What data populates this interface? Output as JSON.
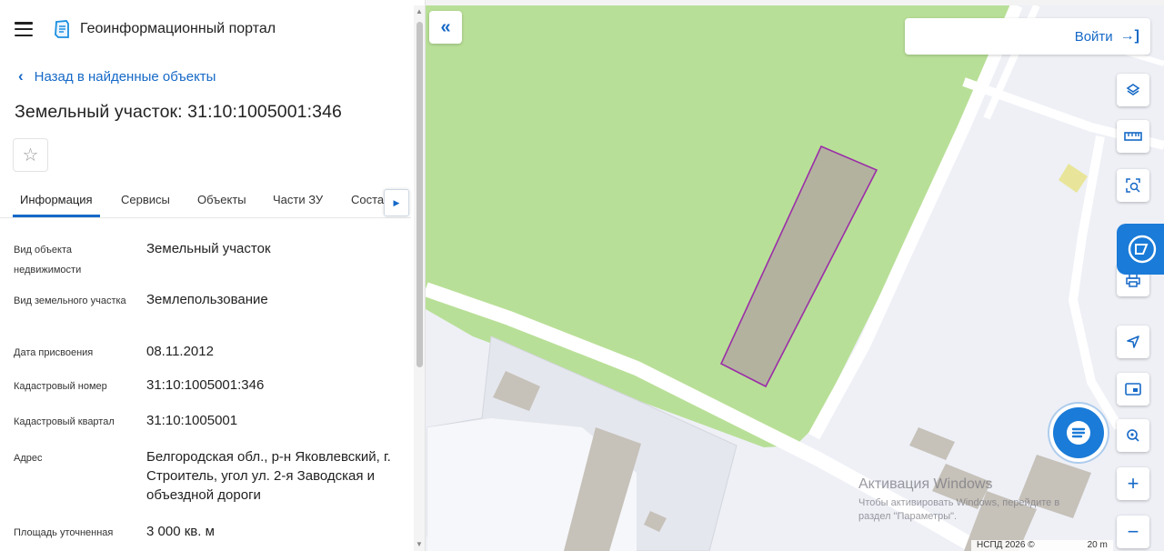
{
  "header": {
    "menu_icon": "hamburger-icon",
    "logo_icon": "portal-logo-icon",
    "title": "Геоинформационный портал"
  },
  "back_link": {
    "label": "Назад в найденные объекты"
  },
  "object": {
    "title": "Земельный участок: 31:10:1005001:346"
  },
  "tabs": [
    {
      "label": "Информация",
      "active": true
    },
    {
      "label": "Сервисы"
    },
    {
      "label": "Объекты"
    },
    {
      "label": "Части ЗУ"
    },
    {
      "label": "Соста"
    }
  ],
  "info_rows": [
    {
      "label": "Вид объекта недвижимости",
      "value": "Земельный участок"
    },
    {
      "label": "Вид земельного участка",
      "value": "Землепользование"
    },
    {
      "label": "Дата присвоения",
      "value": "08.11.2012"
    },
    {
      "label": "Кадастровый номер",
      "value": "31:10:1005001:346"
    },
    {
      "label": "Кадастровый квартал",
      "value": "31:10:1005001"
    },
    {
      "label": "Адрес",
      "value": "Белгородская обл., р-н Яковлевский, г. Строитель, угол ул. 2-я Заводская и объездной дороги"
    },
    {
      "label": "Площадь уточненная",
      "value": "3 000 кв. м"
    }
  ],
  "map": {
    "collapse_symbol": "«",
    "login_label": "Войти",
    "tools": [
      "layers-icon",
      "ruler-icon",
      "area-select-icon",
      "print-icon",
      "locate-icon",
      "minimap-icon",
      "search-area-icon",
      "zoom-in-icon",
      "zoom-out-icon"
    ],
    "zoom_in": "+",
    "zoom_out": "−",
    "parcel_outline_color": "#9b2ea8",
    "green_area_color": "#b8df97",
    "watermark_title": "Активация Windows",
    "watermark_text_1": "Чтобы активировать Windows, перейдите в",
    "watermark_text_2": "раздел \"Параметры\".",
    "attribution": "НСПД 2026 ©",
    "scale": "20 m"
  }
}
